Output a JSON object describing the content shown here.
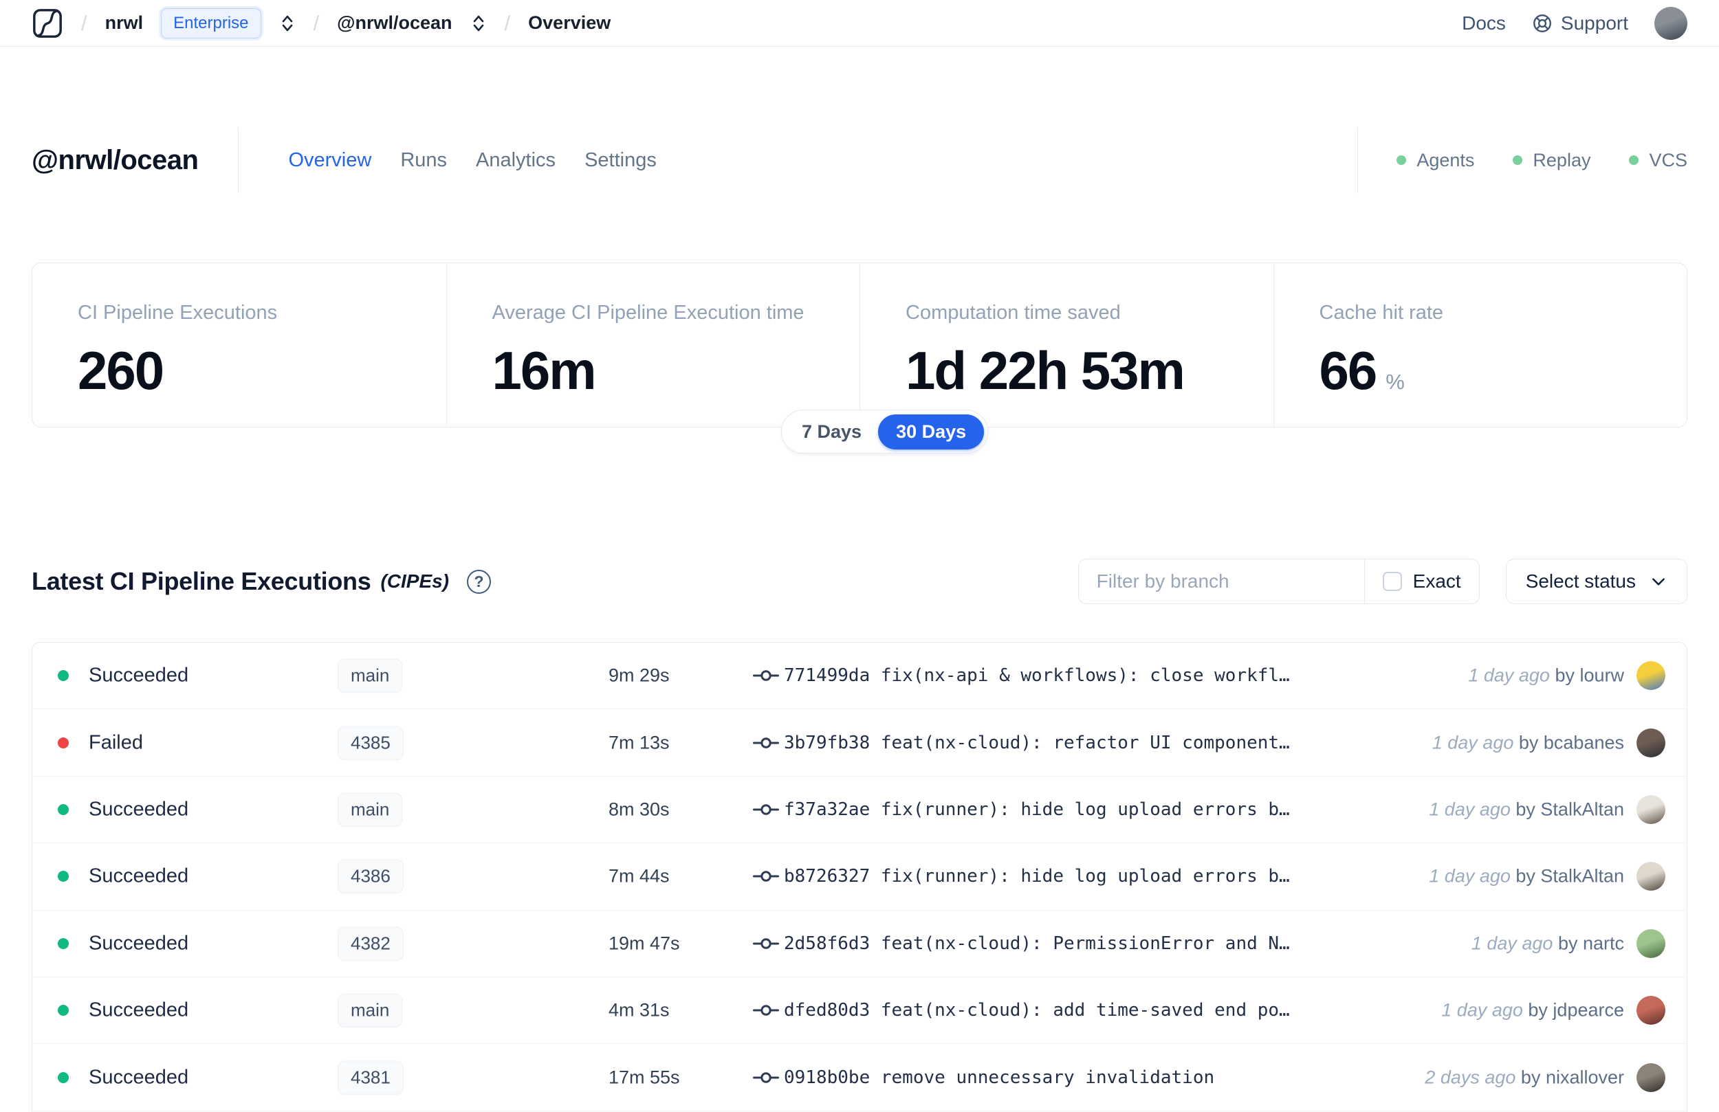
{
  "colors": {
    "accent": "#2563eb",
    "success": "#10b981",
    "danger": "#ef4444",
    "service_dot": "#79d09d"
  },
  "nav": {
    "breadcrumb": {
      "org": "nrwl",
      "badge": "Enterprise",
      "workspace": "@nrwl/ocean",
      "page": "Overview"
    },
    "docs": "Docs",
    "support": "Support",
    "avatar_colors": [
      "#8a8f96",
      "#39434f"
    ]
  },
  "workspace": {
    "title": "@nrwl/ocean",
    "tabs": [
      {
        "label": "Overview",
        "active": true
      },
      {
        "label": "Runs",
        "active": false
      },
      {
        "label": "Analytics",
        "active": false
      },
      {
        "label": "Settings",
        "active": false
      }
    ],
    "services": [
      {
        "label": "Agents"
      },
      {
        "label": "Replay"
      },
      {
        "label": "VCS"
      }
    ]
  },
  "stats": {
    "cards": [
      {
        "label": "CI Pipeline Executions",
        "value": "260",
        "suffix": ""
      },
      {
        "label": "Average CI Pipeline Execution time",
        "value": "16m",
        "suffix": ""
      },
      {
        "label": "Computation time saved",
        "value": "1d 22h 53m",
        "suffix": ""
      },
      {
        "label": "Cache hit rate",
        "value": "66",
        "suffix": "%"
      }
    ],
    "range": {
      "options": [
        "7 Days",
        "30 Days"
      ],
      "selected": "30 Days"
    }
  },
  "executions": {
    "title": "Latest CI Pipeline Executions",
    "title_suffix": "(CIPEs)",
    "filter": {
      "placeholder": "Filter by branch",
      "exact_label": "Exact",
      "status_label": "Select status"
    },
    "rows": [
      {
        "status": "Succeeded",
        "dot_color": "#10b981",
        "branch": "main",
        "duration": "9m 29s",
        "commit": "771499da fix(nx-api & workflows): close workfl…",
        "time": "1 day ago",
        "author": "by lourw",
        "avatar": [
          "#f3cf3e",
          "#4a77c4"
        ]
      },
      {
        "status": "Failed",
        "dot_color": "#ef4444",
        "branch": "4385",
        "duration": "7m 13s",
        "commit": "3b79fb38 feat(nx-cloud): refactor UI component…",
        "time": "1 day ago",
        "author": "by bcabanes",
        "avatar": [
          "#6d5c52",
          "#2a2d36"
        ]
      },
      {
        "status": "Succeeded",
        "dot_color": "#10b981",
        "branch": "main",
        "duration": "8m 30s",
        "commit": "f37a32ae fix(runner): hide log upload errors b…",
        "time": "1 day ago",
        "author": "by StalkAltan",
        "avatar": [
          "#e8e3da",
          "#5a5046"
        ]
      },
      {
        "status": "Succeeded",
        "dot_color": "#10b981",
        "branch": "4386",
        "duration": "7m 44s",
        "commit": "b8726327 fix(runner): hide log upload errors b…",
        "time": "1 day ago",
        "author": "by StalkAltan",
        "avatar": [
          "#ded8cd",
          "#4c443c"
        ]
      },
      {
        "status": "Succeeded",
        "dot_color": "#10b981",
        "branch": "4382",
        "duration": "19m 47s",
        "commit": "2d58f6d3 feat(nx-cloud): PermissionError and N…",
        "time": "1 day ago",
        "author": "by nartc",
        "avatar": [
          "#9fc58f",
          "#46663f"
        ]
      },
      {
        "status": "Succeeded",
        "dot_color": "#10b981",
        "branch": "main",
        "duration": "4m 31s",
        "commit": "dfed80d3 feat(nx-cloud): add time-saved end po…",
        "time": "1 day ago",
        "author": "by jdpearce",
        "avatar": [
          "#c46a5a",
          "#5f2e2a"
        ]
      },
      {
        "status": "Succeeded",
        "dot_color": "#10b981",
        "branch": "4381",
        "duration": "17m 55s",
        "commit": "0918b0be remove unnecessary invalidation",
        "time": "2 days ago",
        "author": "by nixallover",
        "avatar": [
          "#8c8478",
          "#2e2a28"
        ]
      }
    ]
  }
}
